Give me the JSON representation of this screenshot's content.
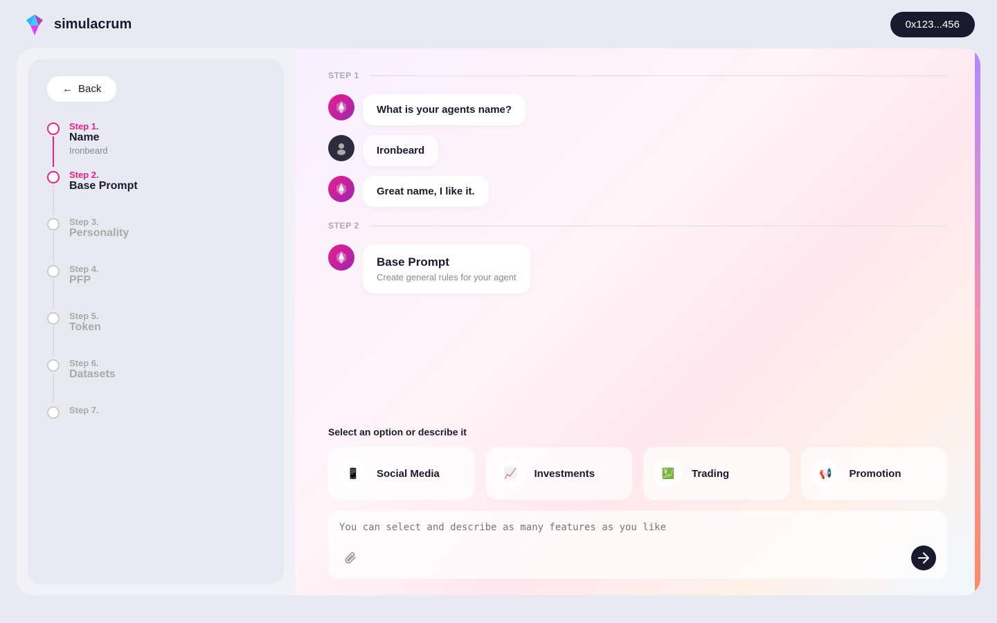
{
  "nav": {
    "logo_text": "simulacrum",
    "wallet_label": "0x123...456"
  },
  "sidebar": {
    "back_label": "Back",
    "steps": [
      {
        "number": "Step 1.",
        "title": "Name",
        "subtitle": "Ironbeard",
        "active": true,
        "completed": true
      },
      {
        "number": "Step 2.",
        "title": "Base Prompt",
        "subtitle": "",
        "active": true,
        "completed": false
      },
      {
        "number": "Step 3.",
        "title": "Personality",
        "subtitle": "",
        "active": false,
        "completed": false
      },
      {
        "number": "Step 4.",
        "title": "PFP",
        "subtitle": "",
        "active": false,
        "completed": false
      },
      {
        "number": "Step 5.",
        "title": "Token",
        "subtitle": "",
        "active": false,
        "completed": false
      },
      {
        "number": "Step 6.",
        "title": "Datasets",
        "subtitle": "",
        "active": false,
        "completed": false
      },
      {
        "number": "Step 7.",
        "title": "",
        "subtitle": "",
        "active": false,
        "completed": false
      }
    ]
  },
  "chat": {
    "step1_label": "STEP 1",
    "step2_label": "STEP 2",
    "messages": [
      {
        "type": "bot",
        "text": "What is your agents name?"
      },
      {
        "type": "user",
        "text": "Ironbeard"
      },
      {
        "type": "bot",
        "text": "Great name, I like it."
      }
    ],
    "base_prompt": {
      "title": "Base Prompt",
      "subtitle": "Create general rules for your agent"
    }
  },
  "bottom": {
    "select_label": "Select an option or describe it",
    "options": [
      {
        "label": "Social Media",
        "icon": "📱"
      },
      {
        "label": "Investments",
        "icon": "📈"
      },
      {
        "label": "Trading",
        "icon": "💹"
      },
      {
        "label": "Promotion",
        "icon": "📢"
      }
    ],
    "input_placeholder": "You can select and describe as many features as you like"
  }
}
